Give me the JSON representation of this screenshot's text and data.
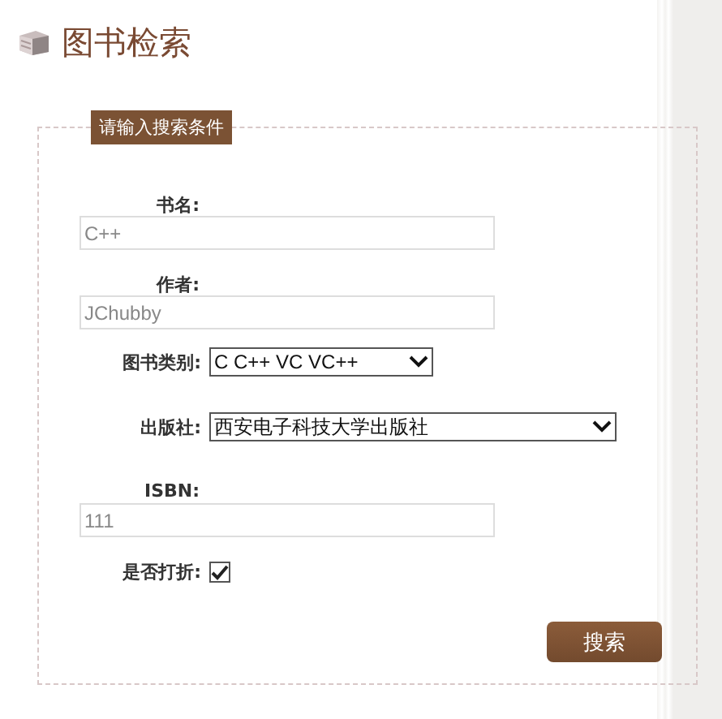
{
  "title": "图书检索",
  "form": {
    "legend": "请输入搜索条件",
    "fields": [
      {
        "kind": "text",
        "label": "书名:",
        "placeholder": "C++"
      },
      {
        "kind": "text",
        "label": "作者:",
        "placeholder": "JChubby"
      },
      {
        "kind": "select",
        "label": "图书类别:",
        "value": "C C++ VC VC++",
        "wide": false
      },
      {
        "kind": "select",
        "label": "出版社:",
        "value": "西安电子科技大学出版社",
        "wide": true
      },
      {
        "kind": "text",
        "label": "ISBN:",
        "placeholder": "111"
      },
      {
        "kind": "checkbox",
        "label": "是否打折:",
        "checked": true
      }
    ],
    "button": "搜索"
  }
}
